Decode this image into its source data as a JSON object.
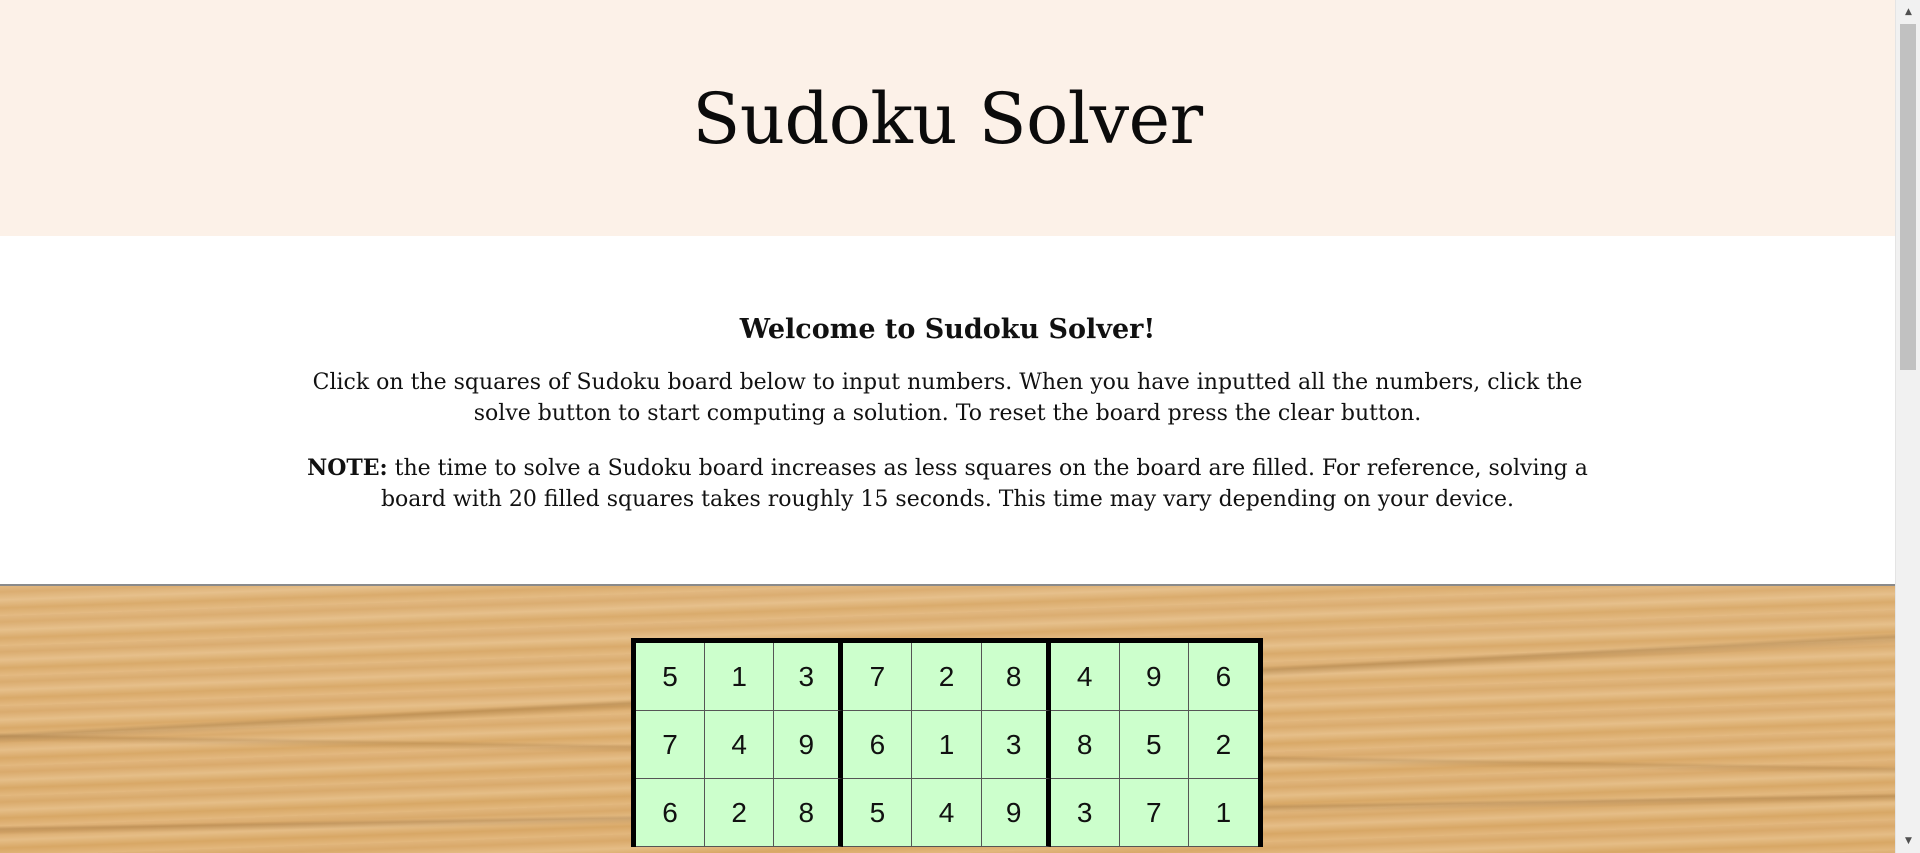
{
  "header": {
    "title": "Sudoku Solver"
  },
  "intro": {
    "heading": "Welcome to Sudoku Solver!",
    "paragraph1": "Click on the squares of Sudoku board below to input numbers. When you have inputted all the numbers, click the solve button to start computing a solution. To reset the board press the clear button.",
    "note_label": "NOTE:",
    "note_text": " the time to solve a Sudoku board increases as less squares on the board are filled. For reference, solving a board with 20 filled squares takes roughly 15 seconds. This time may vary depending on your device."
  },
  "board": {
    "cell_color": "#ccffcc",
    "rows": [
      [
        "5",
        "1",
        "3",
        "7",
        "2",
        "8",
        "4",
        "9",
        "6"
      ],
      [
        "7",
        "4",
        "9",
        "6",
        "1",
        "3",
        "8",
        "5",
        "2"
      ],
      [
        "6",
        "2",
        "8",
        "5",
        "4",
        "9",
        "3",
        "7",
        "1"
      ]
    ]
  },
  "scrollbar": {
    "up_icon": "chevron-up-icon",
    "down_icon": "chevron-down-icon"
  }
}
